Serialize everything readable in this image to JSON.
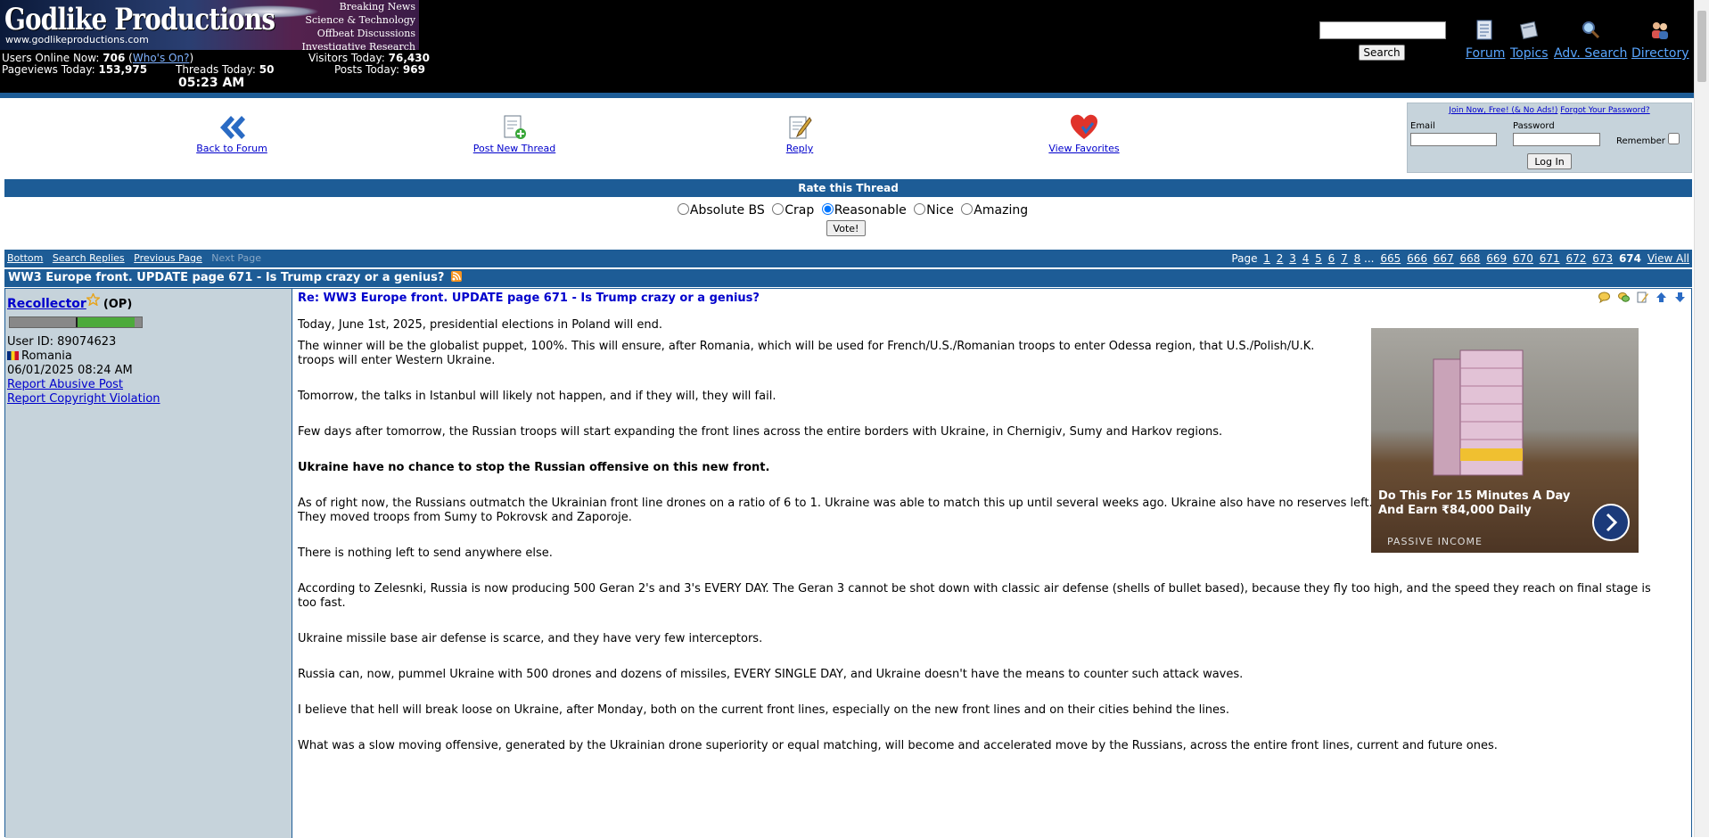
{
  "header": {
    "logo_title": "Godlike Productions",
    "logo_url": "www.godlikeproductions.com",
    "logo_tags": [
      "Breaking News",
      "Science & Technology",
      "Offbeat Discussions",
      "Investigative Research"
    ],
    "users_online_label": "Users Online Now:",
    "users_online_value": "706",
    "whos_on_link": "Who's On?",
    "visitors_today_label": "Visitors Today:",
    "visitors_today_value": "76,430",
    "pageviews_label": "Pageviews Today:",
    "pageviews_value": "153,975",
    "threads_label": "Threads Today:",
    "threads_value": "50",
    "posts_label": "Posts Today:",
    "posts_value": "969",
    "time": "05:23 AM",
    "search_button": "Search",
    "nav": [
      {
        "label": "Forum",
        "icon": "document-icon"
      },
      {
        "label": "Topics",
        "icon": "notebook-icon"
      },
      {
        "label": "Adv. Search",
        "icon": "magnifier-icon"
      },
      {
        "label": "Directory",
        "icon": "users-icon"
      }
    ]
  },
  "actions": {
    "back": "Back to Forum",
    "post_new": "Post New Thread",
    "reply": "Reply",
    "favorites": "View Favorites"
  },
  "login": {
    "join_link": "Join Now, Free! (& No Ads!)",
    "forgot_link": "Forgot Your Password?",
    "email_label": "Email",
    "password_label": "Password",
    "remember_label": "Remember",
    "login_button": "Log In"
  },
  "rate": {
    "title": "Rate this Thread",
    "options": [
      "Absolute BS",
      "Crap",
      "Reasonable",
      "Nice",
      "Amazing"
    ],
    "selected": "Reasonable",
    "vote_button": "Vote!"
  },
  "paging": {
    "left_links": [
      "Bottom",
      "Search Replies",
      "Previous Page"
    ],
    "next_disabled": "Next Page",
    "page_label": "Page",
    "pages": [
      "1",
      "2",
      "3",
      "4",
      "5",
      "6",
      "7",
      "8",
      "...",
      "665",
      "666",
      "667",
      "668",
      "669",
      "670",
      "671",
      "672",
      "673"
    ],
    "current": "674",
    "view_all": "View All"
  },
  "thread": {
    "title": "WW3 Europe front. UPDATE page 671 - Is Trump crazy or a genius?"
  },
  "post": {
    "author": "Recollector",
    "op": "(OP)",
    "user_id": "User ID: 89074623",
    "country": "Romania",
    "datetime": "06/01/2025 08:24 AM",
    "report_abusive": "Report Abusive Post",
    "report_copyright": "Report Copyright Violation",
    "title": "Re: WW3 Europe front. UPDATE page 671 - Is Trump crazy or a genius?",
    "paragraphs": [
      "Today, June 1st, 2025, presidential elections in Poland will end.",
      "The winner will be the globalist puppet, 100%. This will ensure, after Romania, which will be used for French/U.S./Romanian troops to enter Odessa region, that U.S./Polish/U.K. troops will enter Western Ukraine.",
      "Tomorrow, the talks in Istanbul will likely not happen, and if they will, they will fail.",
      "Few days after tomorrow, the Russian troops will start expanding the front lines across the entire borders with Ukraine, in Chernigiv, Sumy and Harkov regions.",
      "Ukraine have no chance to stop the Russian offensive on this new front.",
      "As of right now, the Russians outmatch the Ukrainian front line drones on a ratio of 6 to 1. Ukraine was able to match this up until several weeks ago. Ukraine also have no reserves left. They moved troops from Sumy to Pokrovsk and Zaporoje.",
      "There is nothing left to send anywhere else.",
      "According to Zelesnki, Russia is now producing 500 Geran 2's and 3's EVERY DAY. The Geran 3 cannot be shot down with classic air defense (shells of bullet based), because they fly too high, and the speed they reach on final stage is too fast.",
      "Ukraine missile base air defense is scarce, and they have very few interceptors.",
      "Russia can, now, pummel Ukraine with 500 drones and dozens of missiles, EVERY SINGLE DAY, and Ukraine doesn't have the means to counter such attack waves.",
      "I believe that hell will break loose on Ukraine, after Monday, both on the current front lines, especially on the new front lines and on their cities behind the lines.",
      "What was a slow moving offensive, generated by the Ukrainian drone superiority or equal matching, will become and accelerated move by the Russians, across the entire front lines, current and future ones."
    ]
  },
  "ad": {
    "caption": "Do This For 15 Minutes A Day And Earn ₹84,000 Daily",
    "source": "PASSIVE INCOME"
  },
  "colors": {
    "header_bg": "#000000",
    "bar_blue": "#1d5c96",
    "sidebar_bg": "#c6d3db",
    "link": "#0000cc",
    "nav_link": "#59a6ff"
  }
}
